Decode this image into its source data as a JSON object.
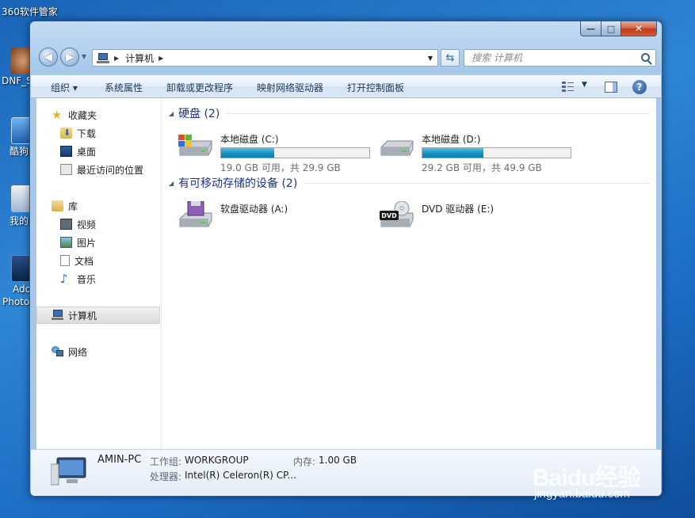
{
  "desktop": {
    "icons": [
      {
        "label": "360软件管家"
      },
      {
        "label": "DNF_S"
      },
      {
        "label": "酷狗"
      },
      {
        "label": "我的"
      },
      {
        "label": "Ado"
      },
      {
        "label": "Photo"
      }
    ]
  },
  "window": {
    "buttons": {
      "minimize": "—",
      "maximize": "□",
      "close": "✕"
    },
    "address": {
      "path": "计算机"
    },
    "search": {
      "placeholder": "搜索 计算机"
    },
    "toolbar": {
      "organize": "组织 ▾",
      "system_properties": "系统属性",
      "uninstall": "卸载或更改程序",
      "map_drive": "映射网络驱动器",
      "control_panel": "打开控制面板"
    },
    "nav": {
      "favorites": "收藏夹",
      "downloads": "下载",
      "desktop": "桌面",
      "recent": "最近访问的位置",
      "libraries": "库",
      "videos": "视频",
      "pictures": "图片",
      "documents": "文档",
      "music": "音乐",
      "computer": "计算机",
      "network": "网络"
    },
    "groups": {
      "hard_disks": "硬盘 (2)",
      "removable": "有可移动存储的设备 (2)"
    },
    "drives": [
      {
        "name": "本地磁盘 (C:)",
        "free": "19.0 GB 可用，共 29.9 GB",
        "used_fraction": 0.36
      },
      {
        "name": "本地磁盘 (D:)",
        "free": "29.2 GB 可用，共 49.9 GB",
        "used_fraction": 0.41
      }
    ],
    "devices": [
      {
        "name": "软盘驱动器 (A:)"
      },
      {
        "name": "DVD 驱动器 (E:)",
        "badge": "DVD"
      }
    ],
    "details": {
      "pc_name": "AMIN-PC",
      "workgroup_label": "工作组:",
      "workgroup": "WORKGROUP",
      "memory_label": "内存:",
      "memory": "1.00 GB",
      "processor_label": "处理器:",
      "processor": "Intel(R) Celeron(R) CP..."
    }
  },
  "watermark": {
    "logo": "Baidu经验",
    "url": "jingyan.baidu.com"
  },
  "colors": {
    "accent": "#1e3287",
    "bar_fill": "#1593c4",
    "desktop_bg": "#2f86d6"
  }
}
